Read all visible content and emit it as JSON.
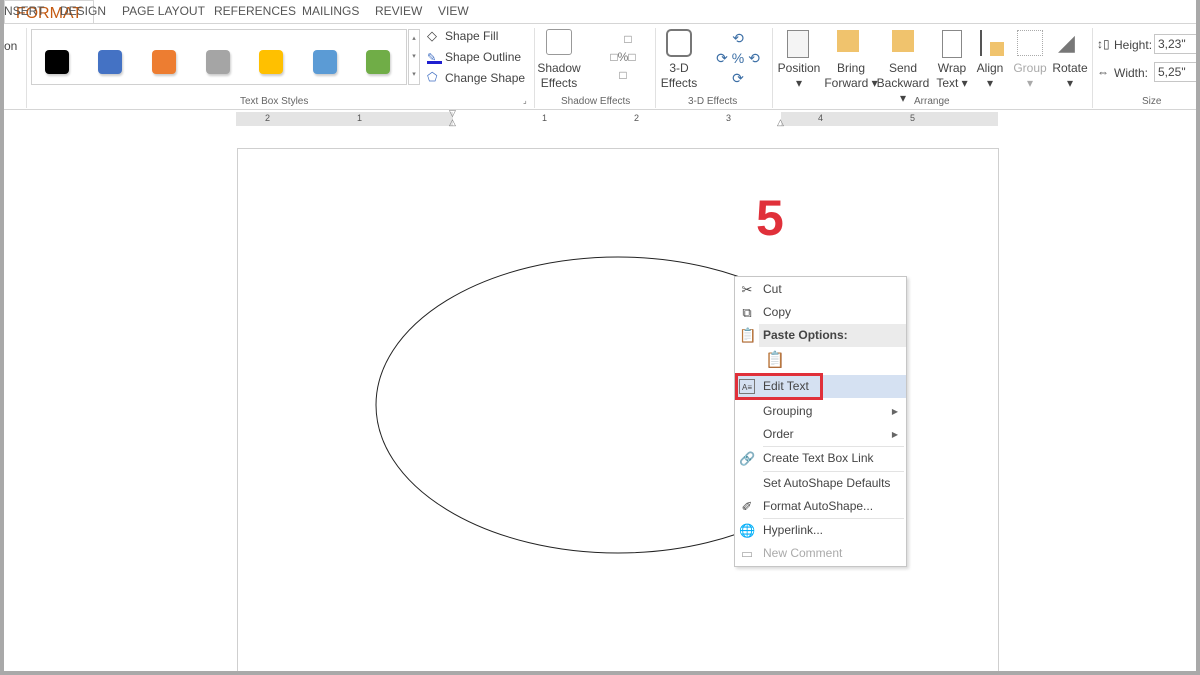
{
  "tabs": [
    "NSERT",
    "DESIGN",
    "PAGE LAYOUT",
    "REFERENCES",
    "MAILINGS",
    "REVIEW",
    "VIEW",
    "FORMAT"
  ],
  "ribbon": {
    "left_fragment": "on",
    "swatches": [
      "#000000",
      "#4472c4",
      "#ed7d31",
      "#a5a5a5",
      "#ffc000",
      "#5b9bd5",
      "#70ad47"
    ],
    "shape_fill": "Shape Fill",
    "shape_outline": "Shape Outline",
    "change_shape": "Change Shape",
    "text_box_styles": "Text Box Styles",
    "shadow_effects_btn": [
      "Shadow",
      "Effects"
    ],
    "shadow_effects_group": "Shadow Effects",
    "three_d_btn": [
      "3-D",
      "Effects"
    ],
    "three_d_group": "3-D Effects",
    "position": "Position",
    "bring": [
      "Bring",
      "Forward"
    ],
    "send": [
      "Send",
      "Backward"
    ],
    "wrap": [
      "Wrap",
      "Text"
    ],
    "align": "Align",
    "group": "Group",
    "rotate": "Rotate",
    "arrange": "Arrange",
    "height_label": "Height:",
    "height_value": "3,23\"",
    "width_label": "Width:",
    "width_value": "5,25\"",
    "size": "Size"
  },
  "ruler": [
    "2",
    "1",
    "1",
    "2",
    "3",
    "4",
    "5"
  ],
  "annotation": "5",
  "menu": {
    "cut": "Cut",
    "copy": "Copy",
    "paste_options": "Paste Options:",
    "edit_text": "Edit Text",
    "grouping": "Grouping",
    "order": "Order",
    "create_link": "Create Text Box Link",
    "set_defaults": "Set AutoShape Defaults",
    "format_autoshape": "Format AutoShape...",
    "hyperlink": "Hyperlink...",
    "new_comment": "New Comment"
  },
  "colors": {
    "highlight": "#e0303a",
    "format_tab": "#c55a11",
    "menu_hover": "#d5e1f2"
  }
}
